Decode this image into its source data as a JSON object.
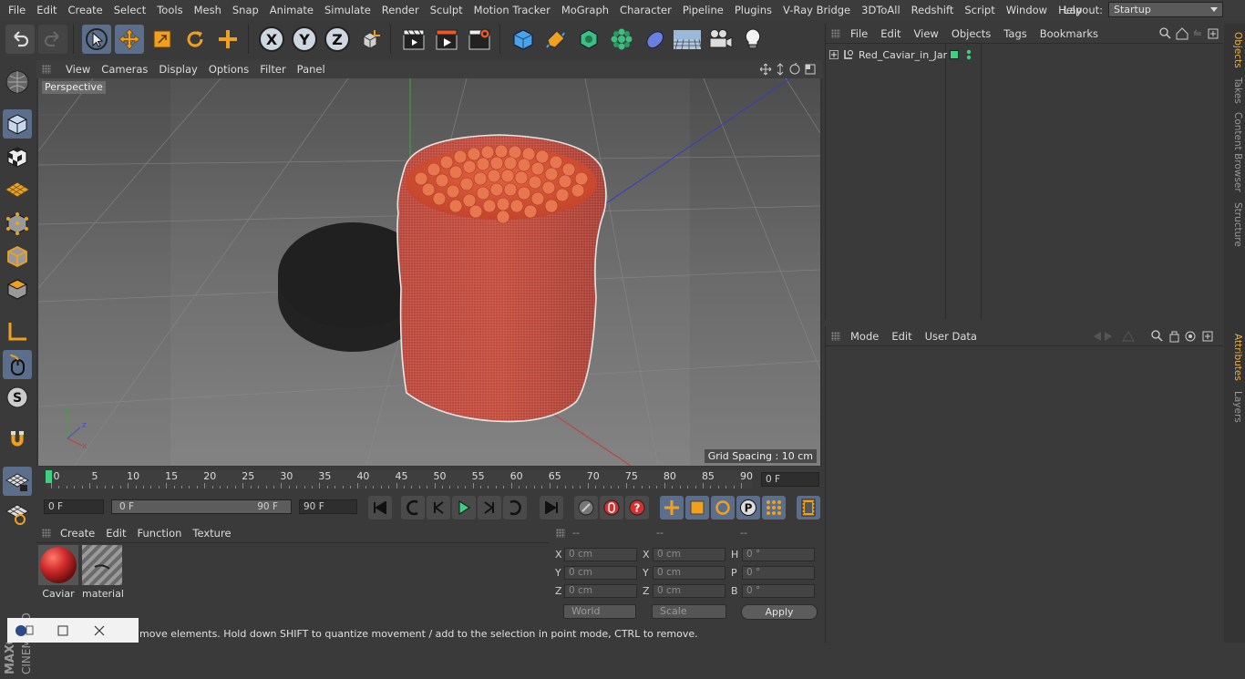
{
  "menubar": {
    "items": [
      "File",
      "Edit",
      "Create",
      "Select",
      "Tools",
      "Mesh",
      "Snap",
      "Animate",
      "Simulate",
      "Render",
      "Sculpt",
      "Motion Tracker",
      "MoGraph",
      "Character",
      "Pipeline",
      "Plugins",
      "V-Ray Bridge",
      "3DToAll",
      "Redshift",
      "Script",
      "Window",
      "Help"
    ]
  },
  "layout": {
    "label": "Layout:",
    "value": "Startup"
  },
  "toolbar": {
    "axis_x": "X",
    "axis_y": "Y",
    "axis_z": "Z"
  },
  "viewport": {
    "menu": [
      "View",
      "Cameras",
      "Display",
      "Options",
      "Filter",
      "Panel"
    ],
    "camera_label": "Perspective",
    "grid_spacing": "Grid Spacing : 10 cm"
  },
  "timeline": {
    "ticks": [
      "0",
      "5",
      "10",
      "15",
      "20",
      "25",
      "30",
      "35",
      "40",
      "45",
      "50",
      "55",
      "60",
      "65",
      "70",
      "75",
      "80",
      "85",
      "90"
    ],
    "current_frame": "0 F"
  },
  "transport": {
    "start": "0 F",
    "range_start": "0 F",
    "range_end": "90 F",
    "end": "90 F"
  },
  "materials": {
    "menu": [
      "Create",
      "Edit",
      "Function",
      "Texture"
    ],
    "items": [
      {
        "label": "Caviar",
        "color": "#d02c2c"
      },
      {
        "label": "material",
        "color": "#9a9a9a"
      }
    ]
  },
  "coordinates": {
    "headers": [
      "--",
      "--",
      "--"
    ],
    "rows": [
      {
        "a": "X",
        "av": "0 cm",
        "b": "X",
        "bv": "0 cm",
        "c": "H",
        "cv": "0 °"
      },
      {
        "a": "Y",
        "av": "0 cm",
        "b": "Y",
        "bv": "0 cm",
        "c": "P",
        "cv": "0 °"
      },
      {
        "a": "Z",
        "av": "0 cm",
        "b": "Z",
        "bv": "0 cm",
        "c": "B",
        "cv": "0 °"
      }
    ],
    "space": "World",
    "mode": "Scale",
    "apply": "Apply"
  },
  "status": "move elements. Hold down SHIFT to quantize movement / add to the selection in point mode, CTRL to remove.",
  "objects": {
    "menu": [
      "File",
      "Edit",
      "View",
      "Objects",
      "Tags",
      "Bookmarks"
    ],
    "items": [
      {
        "name": "Red_Caviar_in_Jar"
      }
    ]
  },
  "attributes": {
    "menu": [
      "Mode",
      "Edit",
      "User Data"
    ]
  },
  "sidetabs": [
    "Objects",
    "Takes",
    "Content Browser",
    "Structure",
    "Attributes",
    "Layers"
  ],
  "brand": {
    "maxon": "MAXON",
    "product": "CINEMA 4D"
  }
}
